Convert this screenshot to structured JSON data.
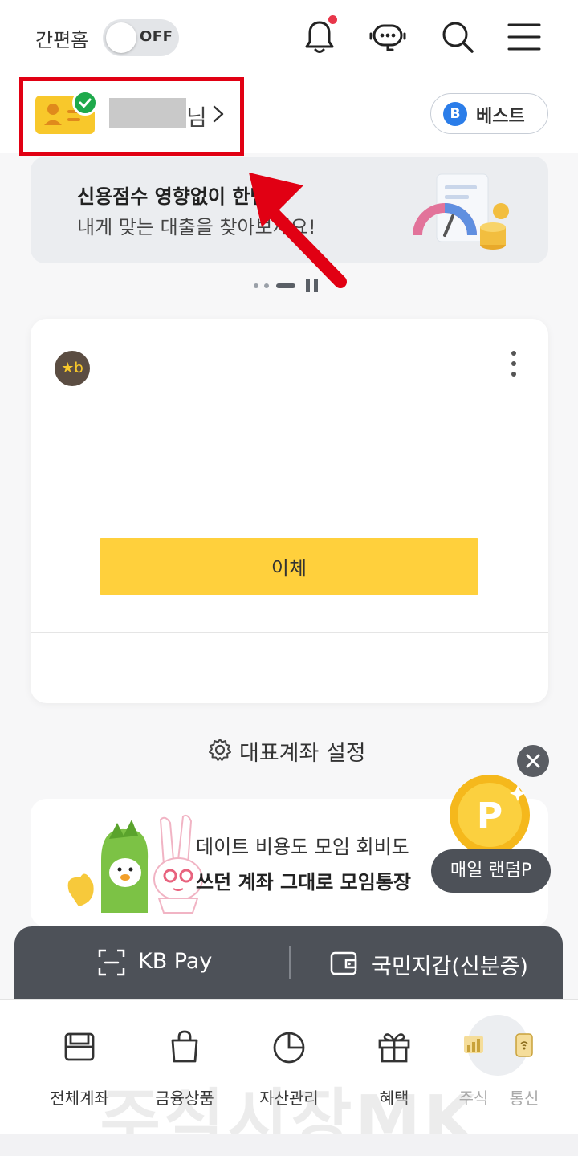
{
  "header": {
    "simple_home_label": "간편홈",
    "toggle_state": "OFF",
    "icons": [
      "bell-icon",
      "chatbot-icon",
      "search-icon",
      "menu-icon"
    ],
    "notification_dot_color": "#e8364a"
  },
  "profile": {
    "name_suffix": "님",
    "grade_letter": "B",
    "grade_label": "베스트"
  },
  "banner": {
    "title": "신용점수 영향없이 한번에",
    "subtitle": "내게 맞는 대출을 찾아보세요!"
  },
  "account_card": {
    "bank_logo_text": "★b",
    "transfer_label": "이체"
  },
  "representative_account": {
    "label": "대표계좌 설정"
  },
  "promo": {
    "line1": "데이트 비용도 모임 회비도",
    "line2": "쓰던 계좌 그대로 모임통장"
  },
  "floating": {
    "coin_letter": "P",
    "random_label": "매일 랜덤P"
  },
  "quick_bar": {
    "kbpay_label": "KB Pay",
    "wallet_label": "국민지갑(신분증)"
  },
  "bottom_nav": {
    "items": [
      {
        "label": "전체계좌",
        "icon": "wallet-account-icon"
      },
      {
        "label": "금융상품",
        "icon": "shopping-bag-icon"
      },
      {
        "label": "자산관리",
        "icon": "pie-chart-icon"
      },
      {
        "label": "혜택",
        "icon": "gift-icon"
      },
      {
        "label": "주식",
        "icon": "stock-chart-icon"
      },
      {
        "label": "통신",
        "icon": "phone-signal-icon"
      }
    ]
  },
  "watermark": "주식시장MK",
  "colors": {
    "accent_yellow": "#ffd03c",
    "dark_bar": "#4d5158",
    "highlight_red": "#e10013",
    "best_badge_blue": "#2b7de9"
  }
}
